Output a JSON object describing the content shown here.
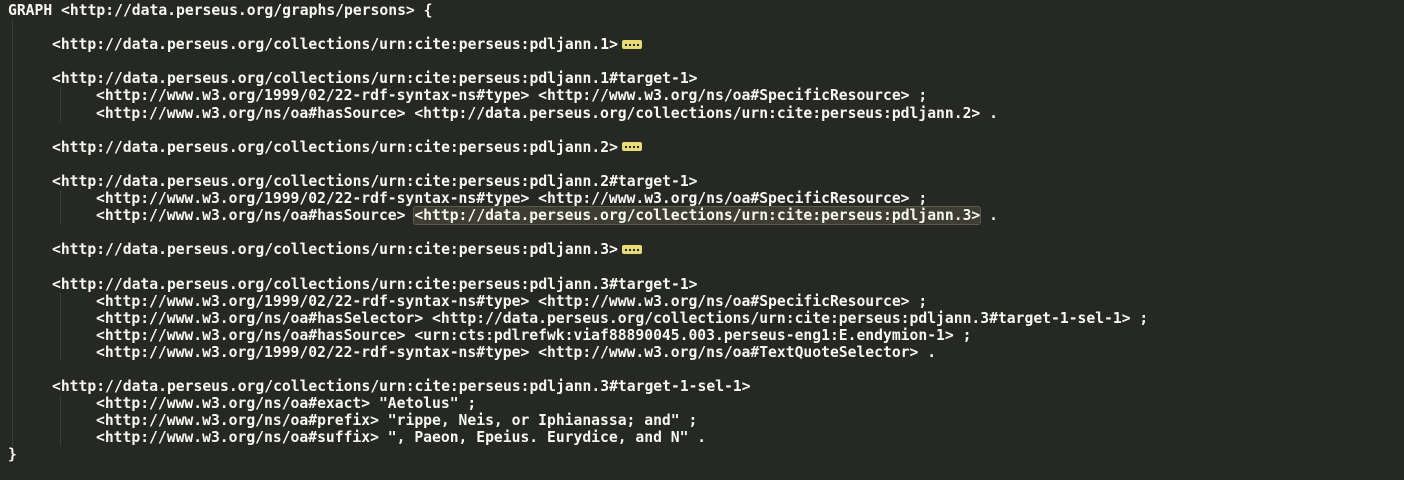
{
  "editor": {
    "lines": [
      {
        "text": "GRAPH <http://data.perseus.org/graphs/persons> {"
      },
      {
        "text": ""
      },
      {
        "text": "<http://data.perseus.org/collections/urn:cite:perseus:pdljann.1>"
      },
      {
        "text": ""
      },
      {
        "text": "<http://data.perseus.org/collections/urn:cite:perseus:pdljann.1#target-1>"
      },
      {
        "text": "<http://www.w3.org/1999/02/22-rdf-syntax-ns#type> <http://www.w3.org/ns/oa#SpecificResource> ;"
      },
      {
        "text": "<http://www.w3.org/ns/oa#hasSource> <http://data.perseus.org/collections/urn:cite:perseus:pdljann.2> ."
      },
      {
        "text": ""
      },
      {
        "text": "<http://data.perseus.org/collections/urn:cite:perseus:pdljann.2>"
      },
      {
        "text": ""
      },
      {
        "text": "<http://data.perseus.org/collections/urn:cite:perseus:pdljann.2#target-1>"
      },
      {
        "text": "<http://www.w3.org/1999/02/22-rdf-syntax-ns#type> <http://www.w3.org/ns/oa#SpecificResource> ;"
      },
      {
        "text": "<http://www.w3.org/ns/oa#hasSource> ",
        "highlight": "<http://data.perseus.org/collections/urn:cite:perseus:pdljann.3>",
        "tail": " ."
      },
      {
        "text": ""
      },
      {
        "text": "<http://data.perseus.org/collections/urn:cite:perseus:pdljann.3>"
      },
      {
        "text": ""
      },
      {
        "text": "<http://data.perseus.org/collections/urn:cite:perseus:pdljann.3#target-1>"
      },
      {
        "text": "<http://www.w3.org/1999/02/22-rdf-syntax-ns#type> <http://www.w3.org/ns/oa#SpecificResource> ;"
      },
      {
        "text": "<http://www.w3.org/ns/oa#hasSelector> <http://data.perseus.org/collections/urn:cite:perseus:pdljann.3#target-1-sel-1> ;"
      },
      {
        "text": "<http://www.w3.org/ns/oa#hasSource> <urn:cts:pdlrefwk:viaf88890045.003.perseus-eng1:E.endymion-1> ;"
      },
      {
        "text": "<http://www.w3.org/1999/02/22-rdf-syntax-ns#type> <http://www.w3.org/ns/oa#TextQuoteSelector> ."
      },
      {
        "text": ""
      },
      {
        "text": "<http://data.perseus.org/collections/urn:cite:perseus:pdljann.3#target-1-sel-1>"
      },
      {
        "text": "<http://www.w3.org/ns/oa#exact> \"Aetolus\" ;"
      },
      {
        "text": "<http://www.w3.org/ns/oa#prefix> \"rippe, Neis, or Iphianassa; and\" ;"
      },
      {
        "text": "<http://www.w3.org/ns/oa#suffix> \", Paeon, Epeius. Eurydice, and N\" ."
      },
      {
        "text": "}"
      }
    ]
  },
  "colors": {
    "background": "#262823",
    "text": "#f8f8f2",
    "fold_marker": "#e6db74",
    "highlight": "#3e3d32"
  }
}
